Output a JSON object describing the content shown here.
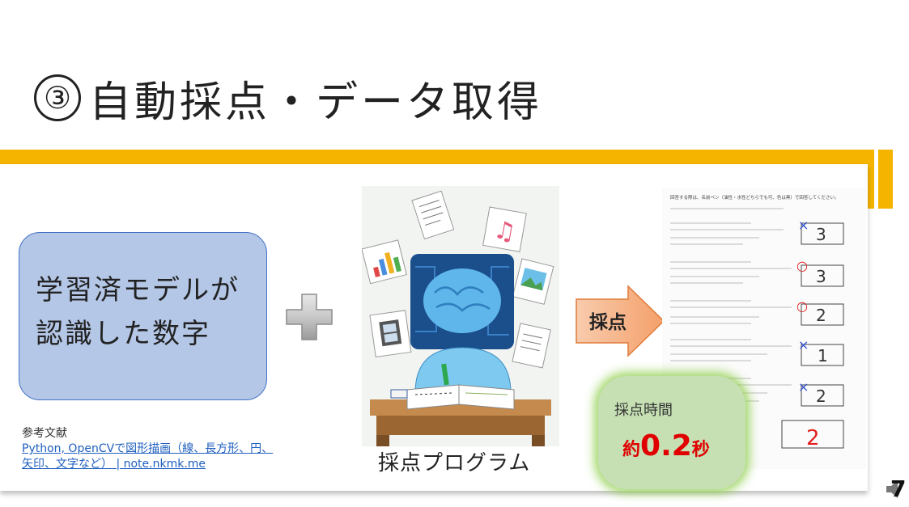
{
  "slide": {
    "title_number": "③",
    "title": "自動採点・データ取得",
    "page_number": "7"
  },
  "model_box": {
    "line1": "学習済モデルが",
    "line2": "認識した数字"
  },
  "reference": {
    "heading": "参考文献",
    "link_line1": "Python, OpenCVで図形描画（線、長方形、円、",
    "link_line2": "矢印、文字など） | note.nkmk.me"
  },
  "program": {
    "label": "採点プログラム"
  },
  "grading_arrow": {
    "label": "採点"
  },
  "answer_sheet": {
    "header": "回答する際は、名前ペン（油性・水性どちらでも可、色は黒）で回答してください。",
    "answers": [
      "3",
      "3",
      "2",
      "1",
      "2"
    ],
    "marks": [
      "×",
      "○",
      "○",
      "×",
      "×"
    ],
    "total": "2"
  },
  "timing": {
    "title": "採点時間",
    "prefix": "約",
    "value": "0.2",
    "unit": "秒"
  },
  "colors": {
    "accent_gold": "#f4b400",
    "model_box_fill": "#b4c7e7",
    "arrow_fill": "#f4b183",
    "time_box_fill": "#c6e0b4",
    "time_value": "#e00000"
  }
}
